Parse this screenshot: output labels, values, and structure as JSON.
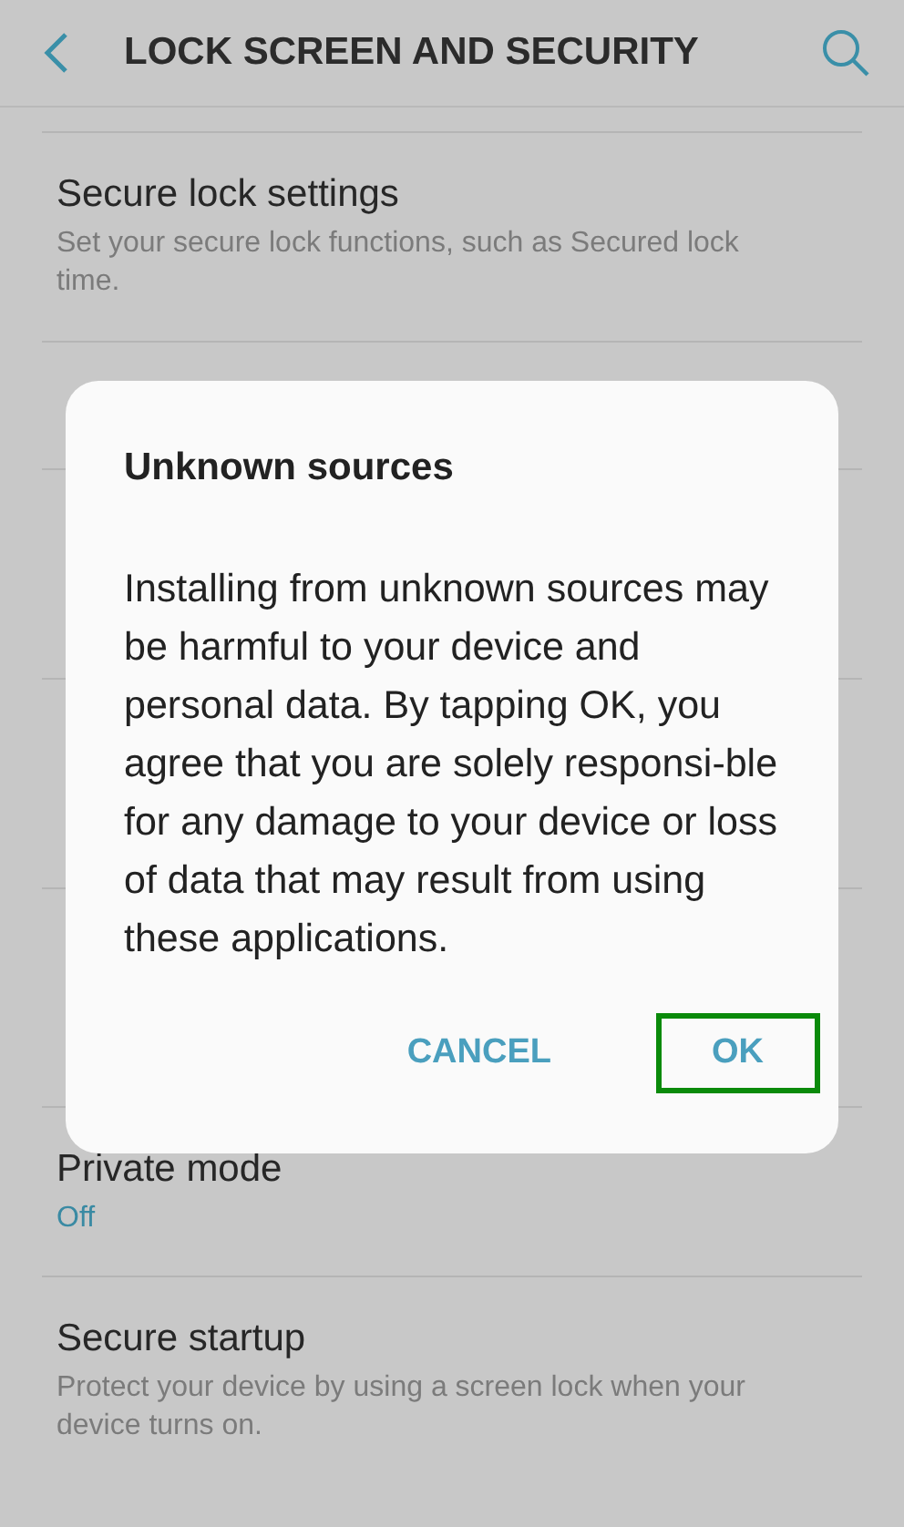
{
  "header": {
    "title": "LOCK SCREEN AND SECURITY"
  },
  "settings": [
    {
      "kind": "item",
      "title": "Secure lock settings",
      "summary": "Set your secure lock functions, such as Secured lock time."
    },
    {
      "kind": "hidden"
    },
    {
      "kind": "hidden"
    },
    {
      "kind": "hidden"
    },
    {
      "kind": "hidden"
    },
    {
      "kind": "status",
      "title": "Private mode",
      "summary": "Off"
    },
    {
      "kind": "item",
      "title": "Secure startup",
      "summary": "Protect your device by using a screen lock when your device turns on."
    }
  ],
  "dialog": {
    "title": "Unknown sources",
    "message": "Installing from unknown sources may be harmful to your device and personal data. By tapping OK, you agree that you are solely responsi-ble for any damage to your device or loss of data that may result from using these applications.",
    "buttons": [
      {
        "label": "CANCEL",
        "highlighted": false
      },
      {
        "label": "OK",
        "highlighted": true
      }
    ]
  }
}
